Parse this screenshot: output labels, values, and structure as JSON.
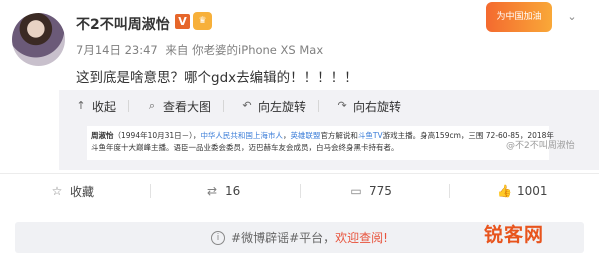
{
  "post": {
    "author": "不2不叫周淑怡",
    "verified_badge": "V",
    "member_badge": "♛",
    "timestamp": "7月14日 23:47",
    "source_prefix": "来自",
    "source": "你老婆的iPhone XS Max",
    "text": "这到底是啥意思？哪个gdx去编辑的！！！！！"
  },
  "promo_badge": "为中国加油",
  "media_tools": [
    {
      "label": "收起",
      "icon": "collapse-up-icon"
    },
    {
      "label": "查看大图",
      "icon": "zoom-in-icon"
    },
    {
      "label": "向左旋转",
      "icon": "rotate-left-icon"
    },
    {
      "label": "向右旋转",
      "icon": "rotate-right-icon"
    }
  ],
  "preview": {
    "line1_a": "周淑怡",
    "line1_b": "（1994年10月31日－），",
    "line1_hl1": "中华人民共和国上海市人",
    "line1_c": "，",
    "line1_hl2": "英雄联盟",
    "line1_d": "官方解说和",
    "line1_hl3": "斗鱼TV",
    "line1_e": "游戏主播。身高159cm，三围 72-60-85，2018年",
    "line2": "斗鱼年度十大巅峰主播。语臣一品业委会委员，迈巴赫车友会成员，白马会终身黑卡持有者。",
    "watermark": "@不2不叫周淑怡"
  },
  "actions": {
    "favorite": "收藏",
    "repost": "16",
    "comment": "775",
    "like": "1001"
  },
  "rumor_bar": {
    "prefix": "#微博辟谣#平台，",
    "link": "欢迎查阅!"
  },
  "site_watermark": "锐客网",
  "colors": {
    "accent_orange": "#e8541d",
    "link_blue": "#3b7dd8",
    "rumor_link": "#e8543d"
  }
}
